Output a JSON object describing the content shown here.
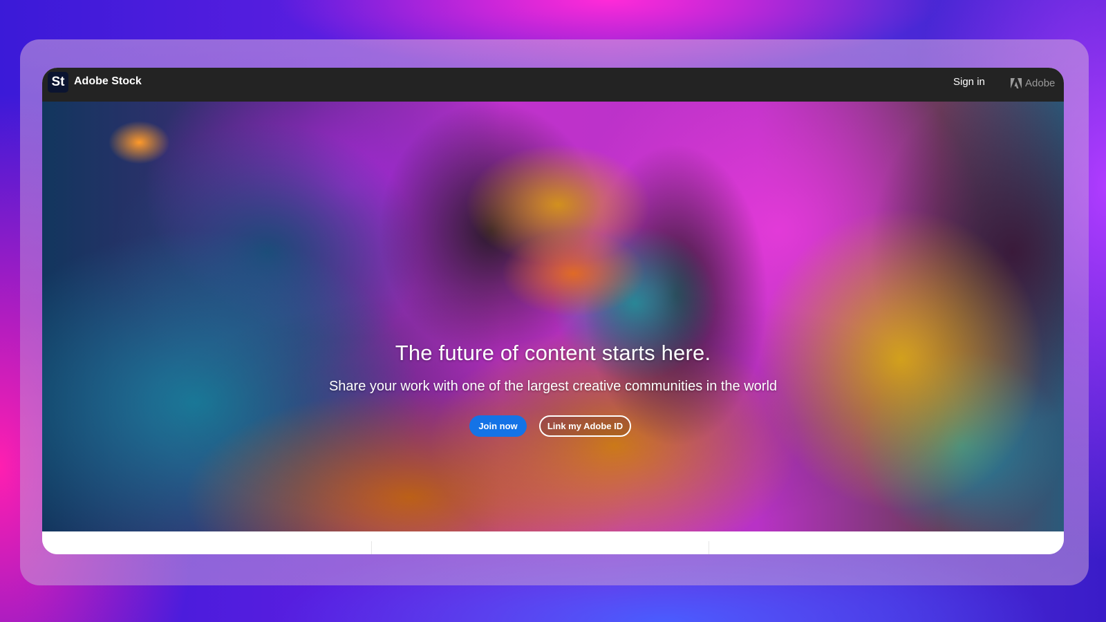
{
  "header": {
    "logo_text": "St",
    "brand_name": "Adobe Stock",
    "sign_in_label": "Sign in",
    "adobe_label": "Adobe"
  },
  "hero": {
    "title": "The future of content starts here.",
    "subtitle": "Share your work with one of the largest creative communities in the world",
    "join_button_label": "Join now",
    "link_button_label": "Link my Adobe ID"
  },
  "colors": {
    "accent_blue": "#1473e6",
    "topbar_bg": "#232323"
  },
  "icons": {
    "logo": "adobe-stock-logo-icon",
    "adobe": "adobe-logo-icon"
  }
}
